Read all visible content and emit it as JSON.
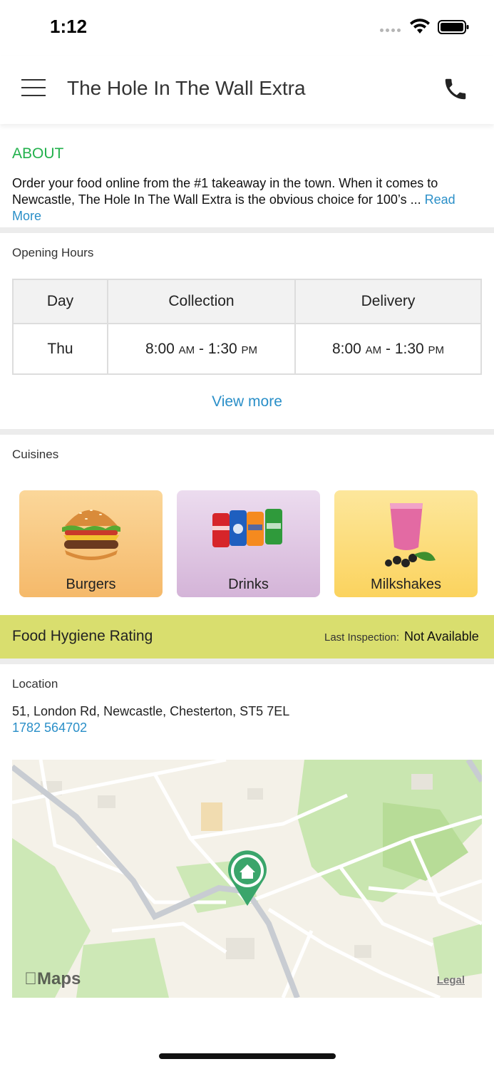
{
  "status": {
    "time": "1:12"
  },
  "header": {
    "title": "The Hole In The Wall Extra"
  },
  "about": {
    "heading": "ABOUT",
    "text": "Order your food online from the #1 takeaway in the town. When it comes to Newcastle, The Hole In The Wall Extra is the obvious choice for 100’s ... ",
    "read_more": "Read More"
  },
  "opening_hours": {
    "label": "Opening Hours",
    "columns": [
      "Day",
      "Collection",
      "Delivery"
    ],
    "rows": [
      {
        "day": "Thu",
        "collection": {
          "start": "8:00",
          "start_ampm": "AM",
          "sep": " - ",
          "end": "1:30",
          "end_ampm": "PM"
        },
        "delivery": {
          "start": "8:00",
          "start_ampm": "AM",
          "sep": " - ",
          "end": "1:30",
          "end_ampm": "PM"
        }
      }
    ],
    "view_more": "View more"
  },
  "cuisines": {
    "label": "Cuisines",
    "items": [
      {
        "label": "Burgers",
        "icon": "burger-icon"
      },
      {
        "label": "Drinks",
        "icon": "soda-cans-icon"
      },
      {
        "label": "Milkshakes",
        "icon": "milkshake-icon"
      }
    ]
  },
  "hygiene": {
    "title": "Food Hygiene Rating",
    "inspection_label": "Last Inspection:",
    "inspection_value": "Not Available",
    "color": "#d9de6e"
  },
  "location": {
    "label": "Location",
    "address": "51, London Rd, Newcastle, Chesterton, ST5 7EL",
    "phone": "1782 564702",
    "map_logo": "Maps",
    "legal": "Legal"
  },
  "colors": {
    "accent_green": "#23b14d",
    "link_blue": "#2a8fc8",
    "pin_green": "#3aa56b"
  }
}
